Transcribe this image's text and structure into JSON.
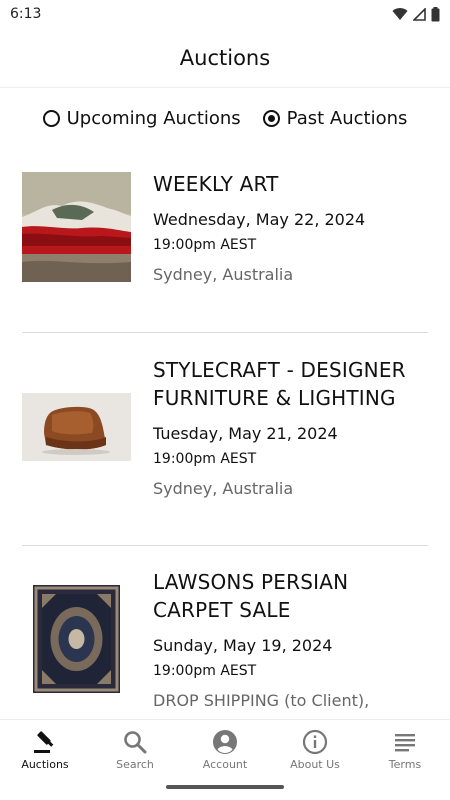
{
  "status_bar": {
    "time": "6:13"
  },
  "app_bar": {
    "title": "Auctions"
  },
  "filters": [
    {
      "label": "Upcoming Auctions",
      "selected": false
    },
    {
      "label": "Past Auctions",
      "selected": true
    }
  ],
  "auctions": [
    {
      "title_lines": [
        "WEEKLY ART"
      ],
      "date": "Wednesday, May 22, 2024",
      "time": "19:00pm AEST",
      "location": "Sydney, Australia",
      "image": "landscape-painting-thumbnail"
    },
    {
      "title_lines": [
        "STYLECRAFT - DESIGNER",
        "FURNITURE & LIGHTING"
      ],
      "date": "Tuesday, May 21, 2024",
      "time": "19:00pm AEST",
      "location": "Sydney, Australia",
      "image": "leather-chair-thumbnail"
    },
    {
      "title_lines": [
        "LAWSONS PERSIAN",
        "CARPET SALE"
      ],
      "date": "Sunday, May 19, 2024",
      "time": "19:00pm AEST",
      "location": "DROP SHIPPING (to Client),",
      "image": "persian-carpet-thumbnail"
    }
  ],
  "bottom_nav": [
    {
      "label": "Auctions",
      "icon": "gavel-icon",
      "active": true
    },
    {
      "label": "Search",
      "icon": "search-icon",
      "active": false
    },
    {
      "label": "Account",
      "icon": "account-icon",
      "active": false
    },
    {
      "label": "About Us",
      "icon": "info-icon",
      "active": false
    },
    {
      "label": "Terms",
      "icon": "menu-lines-icon",
      "active": false
    }
  ],
  "colors": {
    "primary_text": "#111111",
    "secondary_text": "#666666",
    "inactive_nav": "#777777"
  }
}
